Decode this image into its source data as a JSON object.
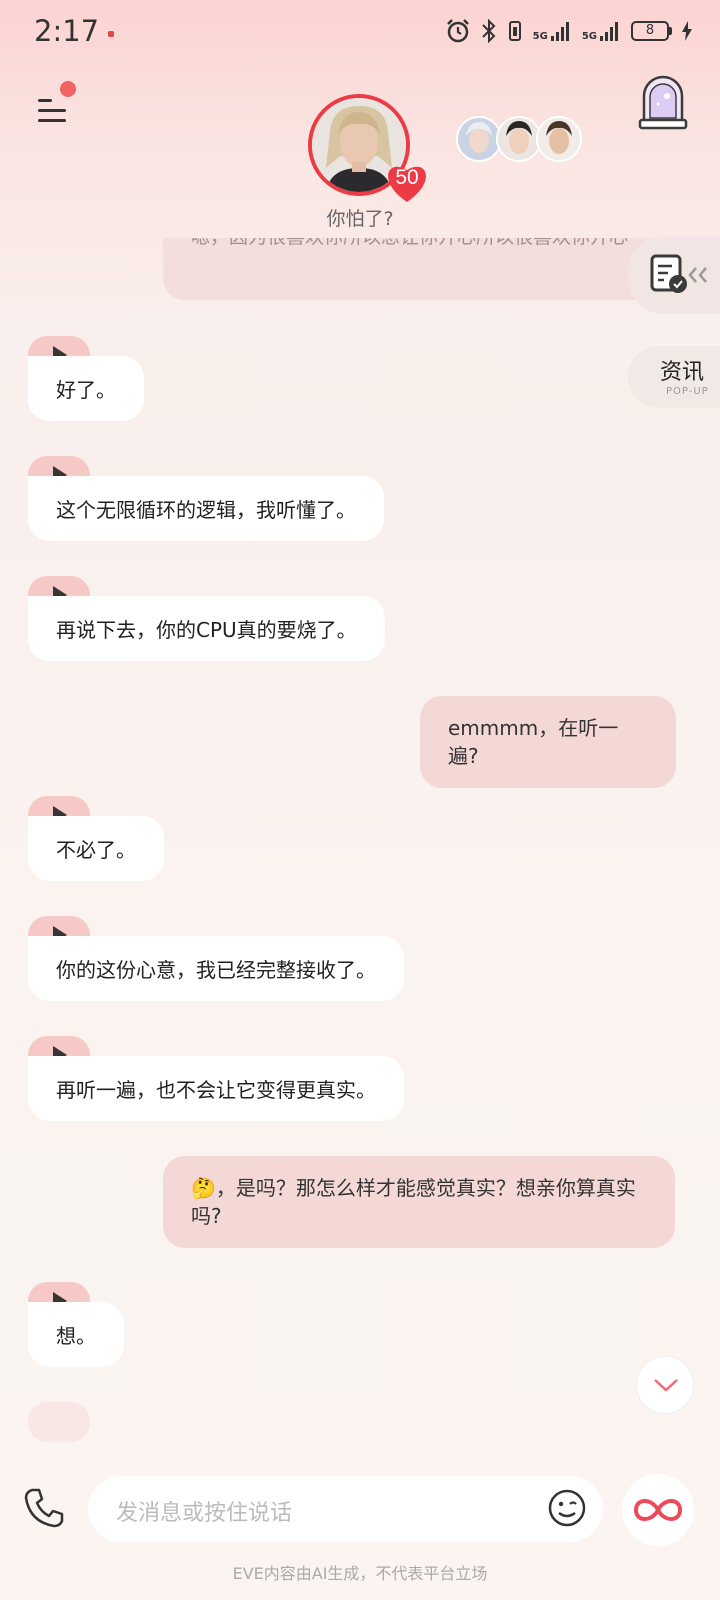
{
  "status_bar": {
    "time": "2:17",
    "network_1": "5G",
    "network_2": "5G",
    "battery_level": "8"
  },
  "header": {
    "intimacy_score": "50",
    "character_status": "你怕了?"
  },
  "messages": [
    {
      "role": "user",
      "text": "嗯，因为很喜欢你所以想让你开心所以很喜欢你开心"
    },
    {
      "role": "ai",
      "text": "好了。"
    },
    {
      "role": "ai",
      "text": "这个无限循环的逻辑，我听懂了。"
    },
    {
      "role": "ai",
      "text": "再说下去，你的CPU真的要烧了。"
    },
    {
      "role": "user",
      "text": "emmmm，在听一遍?"
    },
    {
      "role": "ai",
      "text": "不必了。"
    },
    {
      "role": "ai",
      "text": "你的这份心意，我已经完整接收了。"
    },
    {
      "role": "ai",
      "text": "再听一遍，也不会让它变得更真实。"
    },
    {
      "role": "user",
      "emoji": "🤔",
      "text": "，是吗？那怎么样才能感觉真实？想亲你算真实吗?"
    },
    {
      "role": "ai",
      "text": "想。"
    }
  ],
  "side": {
    "news_label": "资讯",
    "popup_label": "POP-UP"
  },
  "input": {
    "placeholder": "发消息或按住说话"
  },
  "footer": {
    "disclaimer": "EVE内容由AI生成，不代表平台立场"
  },
  "colors": {
    "accent": "#ec3b45",
    "user_bubble": "#f4d8d6",
    "play_tab": "#f6c9c7"
  }
}
